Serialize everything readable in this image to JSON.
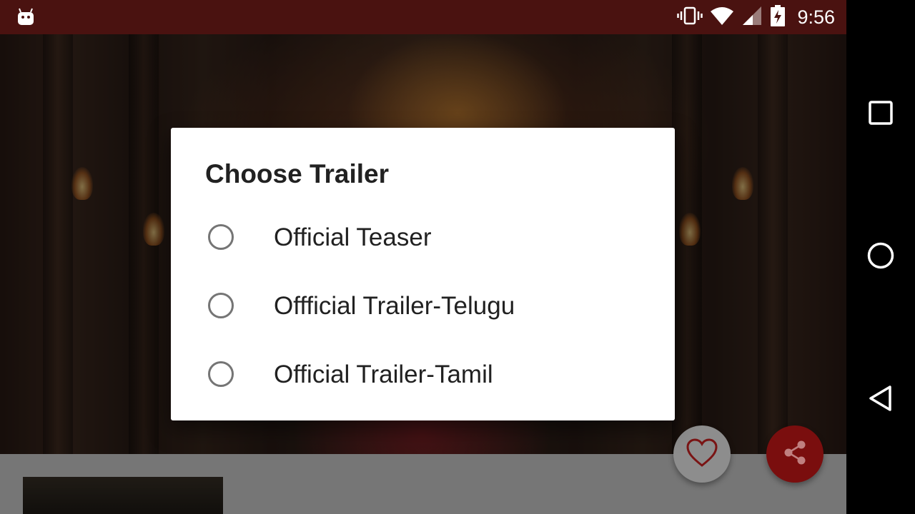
{
  "status_bar": {
    "time": "9:56",
    "icons": [
      "android-notification-icon",
      "vibrate-icon",
      "wifi-icon",
      "cell-signal-icon",
      "battery-charging-icon"
    ]
  },
  "dialog": {
    "title": "Choose Trailer",
    "options": [
      {
        "label": "Official Teaser",
        "selected": false
      },
      {
        "label": "Offficial Trailer-Telugu",
        "selected": false
      },
      {
        "label": "Official Trailer-Tamil",
        "selected": false
      }
    ]
  },
  "fabs": {
    "favorite_icon": "heart-icon",
    "share_icon": "share-icon"
  },
  "navigation_bar": {
    "buttons": [
      "recents-square-icon",
      "home-circle-icon",
      "back-triangle-icon"
    ]
  },
  "colors": {
    "status_bar": "#4a1210",
    "dialog_bg": "#ffffff",
    "text_primary": "#212121",
    "radio_border": "#757575",
    "share_fab": "#7a0e0e"
  }
}
